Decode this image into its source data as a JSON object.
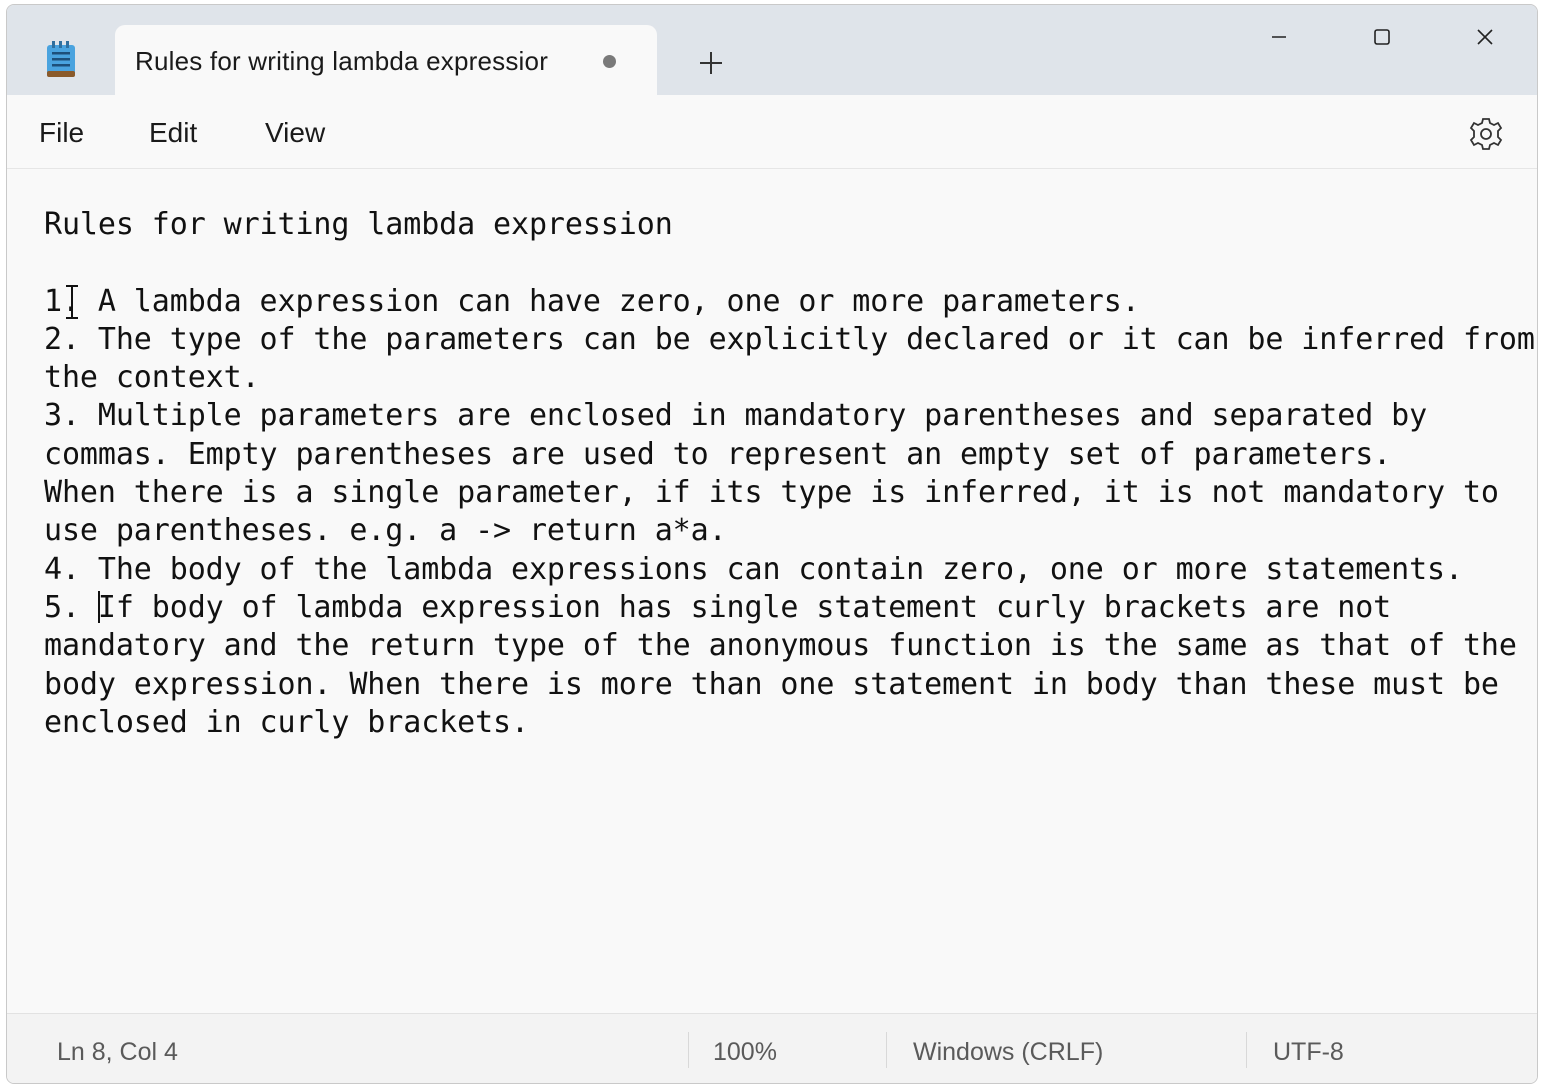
{
  "window": {
    "tab_title": "Rules for writing lambda expressior",
    "icons": {
      "app": "notepad-icon",
      "new_tab": "plus-icon",
      "minimize": "minimize-icon",
      "maximize": "maximize-icon",
      "close": "close-icon",
      "settings": "gear-icon"
    }
  },
  "menu": {
    "file": "File",
    "edit": "Edit",
    "view": "View"
  },
  "document": {
    "lines": [
      "Rules for writing lambda expression",
      "",
      "1. A lambda expression can have zero, one or more parameters.",
      "2. The type of the parameters can be explicitly declared or it can be inferred from",
      "the context.",
      "3. Multiple parameters are enclosed in mandatory parentheses and separated by",
      "commas. Empty parentheses are used to represent an empty set of parameters.",
      "When there is a single parameter, if its type is inferred, it is not mandatory to",
      "use parentheses. e.g. a -> return a*a.",
      "4. The body of the lambda expressions can contain zero, one or more statements.",
      "5. ",
      "If body of lambda expression has single statement curly brackets are not",
      "mandatory and the return type of the anonymous function is the same as that of the",
      "body expression. When there is more than one statement in body than these must be",
      "enclosed in curly brackets."
    ]
  },
  "status": {
    "position": "Ln 8, Col 4",
    "zoom": "100%",
    "line_ending": "Windows (CRLF)",
    "encoding": "UTF-8"
  }
}
